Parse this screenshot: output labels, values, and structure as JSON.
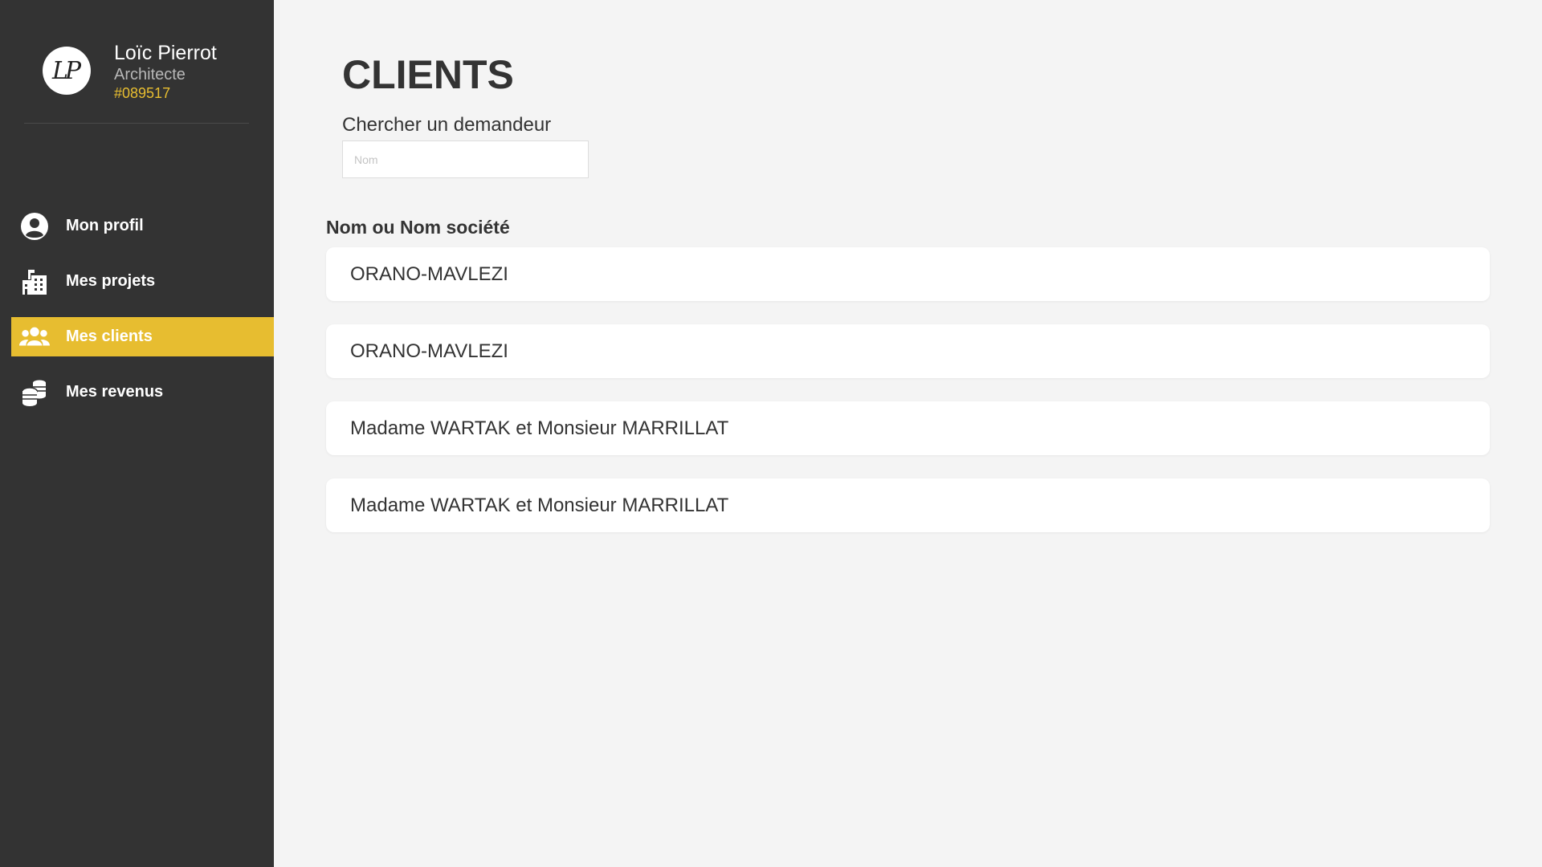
{
  "profile": {
    "logo_text": "LP",
    "name": "Loïc Pierrot",
    "role": "Architecte",
    "id": "#089517"
  },
  "nav": {
    "items": [
      {
        "label": "Mon profil",
        "icon": "user-circle-icon",
        "active": false
      },
      {
        "label": "Mes projets",
        "icon": "building-icon",
        "active": false
      },
      {
        "label": "Mes clients",
        "icon": "users-icon",
        "active": true
      },
      {
        "label": "Mes revenus",
        "icon": "coins-icon",
        "active": false
      }
    ]
  },
  "page": {
    "title": "CLIENTS",
    "search_label": "Chercher un demandeur",
    "search_placeholder": "Nom",
    "search_value": ""
  },
  "clients": {
    "header": "Nom ou Nom société",
    "rows": [
      "ORANO-MAVLEZI",
      "ORANO-MAVLEZI",
      "Madame WARTAK et Monsieur MARRILLAT",
      "Madame WARTAK et Monsieur MARRILLAT"
    ]
  },
  "colors": {
    "sidebar_bg": "#333333",
    "accent": "#e7bd30",
    "page_bg": "#f4f4f4",
    "card_bg": "#ffffff"
  }
}
